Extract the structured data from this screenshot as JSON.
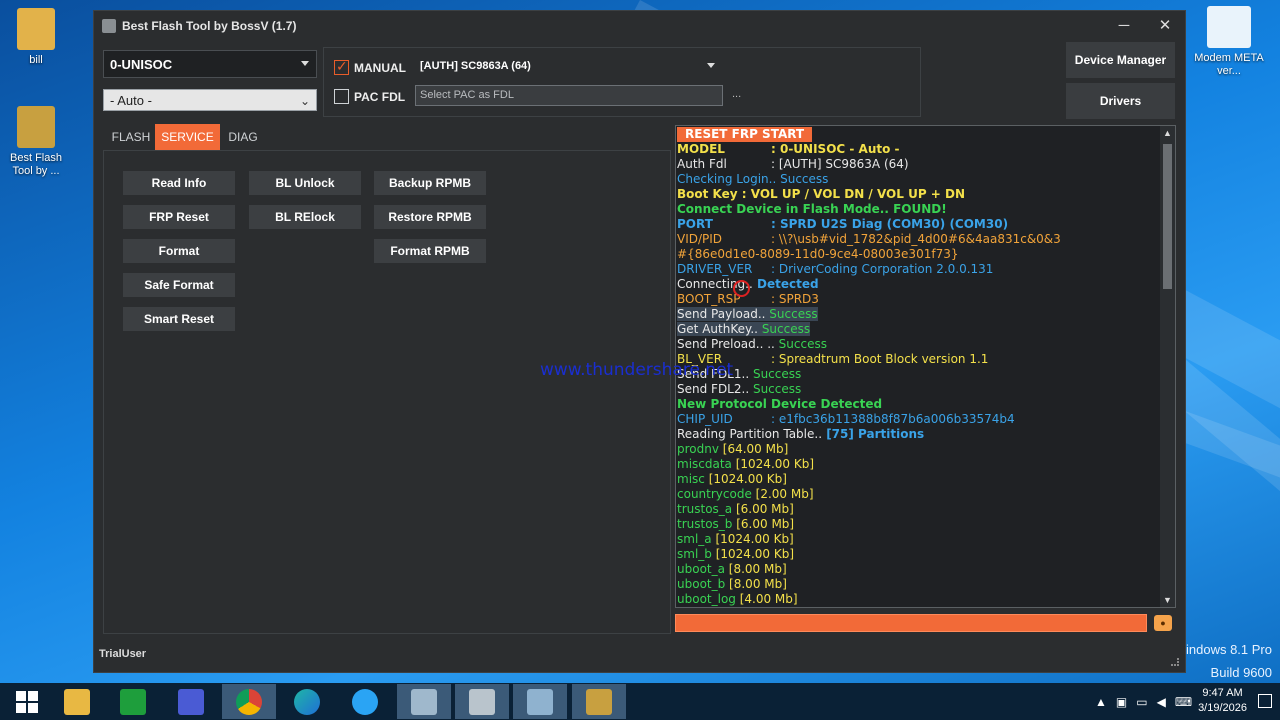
{
  "desktop": {
    "icons": [
      {
        "label": "bill"
      },
      {
        "label": "Best Flash Tool by ..."
      },
      {
        "label": "Modem META ver..."
      }
    ],
    "os_watermark": {
      "line1": "indows 8.1 Pro",
      "line2": "Build 9600"
    }
  },
  "window": {
    "title": "Best Flash Tool by BossV (1.7)",
    "minimize": "─",
    "close": "✕"
  },
  "platform_select": {
    "value": "0-UNISOC"
  },
  "mode_select": {
    "value": "- Auto -"
  },
  "manual": {
    "label": "MANUAL",
    "checked": true,
    "value": "[AUTH] SC9863A (64)"
  },
  "pac_fdl": {
    "label": "PAC FDL",
    "checked": false,
    "placeholder": "Select PAC as FDL",
    "browse": "..."
  },
  "side_buttons": {
    "device_manager": "Device Manager",
    "drivers": "Drivers"
  },
  "tabs": [
    {
      "label": "FLASH",
      "active": false
    },
    {
      "label": "SERVICE",
      "active": true
    },
    {
      "label": "DIAG",
      "active": false
    }
  ],
  "service_buttons": {
    "read_info": "Read Info",
    "frp_reset": "FRP Reset",
    "format": "Format",
    "safe_format": "Safe Format",
    "smart_reset": "Smart Reset",
    "bl_unlock": "BL Unlock",
    "bl_relock": "BL RElock",
    "backup_rpmb": "Backup RPMB",
    "restore_rpmb": "Restore RPMB",
    "format_rpmb": "Format RPMB"
  },
  "log": {
    "banner": "RESET FRP START",
    "lines": [
      {
        "k": "MODEL",
        "v": ": 0-UNISOC - Auto -",
        "color": "#f3e04a",
        "bold": true
      },
      {
        "k": "Auth Fdl",
        "v": ": [AUTH] SC9863A (64)",
        "color": "#e8e8e8"
      },
      {
        "text": "Checking Login..",
        "tail": " Success",
        "color": "#3aa3e8",
        "tailcolor": "#3aa3e8"
      },
      {
        "text": "Boot Key : VOL UP / VOL DN / VOL UP + DN",
        "color": "#f3e04a",
        "bold": true
      },
      {
        "text": "Connect Device in Flash Mode.. FOUND!",
        "color": "#39d353",
        "bold": true
      },
      {
        "k": "PORT",
        "v": ": SPRD U2S Diag (COM30) (COM30)",
        "color": "#3aa3e8",
        "bold": true
      },
      {
        "k": "VID/PID",
        "v": ": \\\\?\\usb#vid_1782&pid_4d00#6&4aa831c&0&3",
        "color": "#f2a43a"
      },
      {
        "text": "#{86e0d1e0-8089-11d0-9ce4-08003e301f73}",
        "color": "#f2a43a"
      },
      {
        "k": "DRIVER_VER",
        "v": ": DriverCoding Corporation  2.0.0.131",
        "color": "#3aa3e8"
      },
      {
        "text": "Connecting..",
        "tail": " Detected",
        "color": "#e8e8e8",
        "tailcolor": "#3aa3e8",
        "tailbold": true
      },
      {
        "k": "BOOT_RSP",
        "v": ": SPRD3",
        "color": "#f2a43a"
      },
      {
        "text": "Send Payload..",
        "tail": " Success",
        "color": "#e8e8e8",
        "tailcolor": "#39d353",
        "hl": true
      },
      {
        "text": "Get AuthKey..",
        "tail": " Success",
        "color": "#e8e8e8",
        "tailcolor": "#39d353",
        "hl": true
      },
      {
        "text": "Send Preload.. ..",
        "tail": " Success",
        "color": "#e8e8e8",
        "tailcolor": "#39d353"
      },
      {
        "k": "BL_VER",
        "v": ": Spreadtrum Boot Block version 1.1",
        "color": "#f3e04a"
      },
      {
        "text": "Send FDL1..",
        "tail": " Success",
        "color": "#e8e8e8",
        "tailcolor": "#39d353"
      },
      {
        "text": "Send FDL2..",
        "tail": " Success",
        "color": "#e8e8e8",
        "tailcolor": "#39d353"
      },
      {
        "text": "New Protocol Device Detected",
        "color": "#39d353",
        "bold": true
      },
      {
        "k": "CHIP_UID",
        "v": ": e1fbc36b11388b8f87b6a006b33574b4",
        "color": "#3aa3e8"
      },
      {
        "text": "Reading Partition Table..",
        "tail": "  [75] Partitions",
        "color": "#e8e8e8",
        "tailcolor": "#3aa3e8",
        "tailbold": true
      },
      {
        "text": "prodnv",
        "tail": "  [64.00 Mb]",
        "color": "#39d353",
        "tailcolor": "#f3e04a"
      },
      {
        "text": "miscdata",
        "tail": "  [1024.00 Kb]",
        "color": "#39d353",
        "tailcolor": "#f3e04a"
      },
      {
        "text": "misc",
        "tail": "  [1024.00 Kb]",
        "color": "#39d353",
        "tailcolor": "#f3e04a"
      },
      {
        "text": "countrycode",
        "tail": "  [2.00 Mb]",
        "color": "#39d353",
        "tailcolor": "#f3e04a"
      },
      {
        "text": "trustos_a",
        "tail": "  [6.00 Mb]",
        "color": "#39d353",
        "tailcolor": "#f3e04a"
      },
      {
        "text": "trustos_b",
        "tail": "  [6.00 Mb]",
        "color": "#39d353",
        "tailcolor": "#f3e04a"
      },
      {
        "text": "sml_a",
        "tail": "  [1024.00 Kb]",
        "color": "#39d353",
        "tailcolor": "#f3e04a"
      },
      {
        "text": "sml_b",
        "tail": "  [1024.00 Kb]",
        "color": "#39d353",
        "tailcolor": "#f3e04a"
      },
      {
        "text": "uboot_a",
        "tail": "  [8.00 Mb]",
        "color": "#39d353",
        "tailcolor": "#f3e04a"
      },
      {
        "text": "uboot_b",
        "tail": "  [8.00 Mb]",
        "color": "#39d353",
        "tailcolor": "#f3e04a"
      },
      {
        "text": "uboot_log",
        "tail": "  [4.00 Mb]",
        "color": "#39d353",
        "tailcolor": "#f3e04a"
      }
    ]
  },
  "status": {
    "user": "TrialUser"
  },
  "overlay_watermark": "www.thundershare.net",
  "colors": {
    "accent": "#f26a38",
    "window_bg": "#2b2d2f",
    "log_bg": "#1f2124"
  },
  "taskbar": {
    "items": [
      "start-icon",
      "file-explorer-icon",
      "store-icon",
      "settings-icon",
      "chrome-icon",
      "edge-icon",
      "ie-icon",
      "app-icon-1",
      "app-icon-2",
      "app-icon-3",
      "best-flash-tool-icon"
    ],
    "time": "9:47 AM",
    "date": "3/19/2026"
  }
}
